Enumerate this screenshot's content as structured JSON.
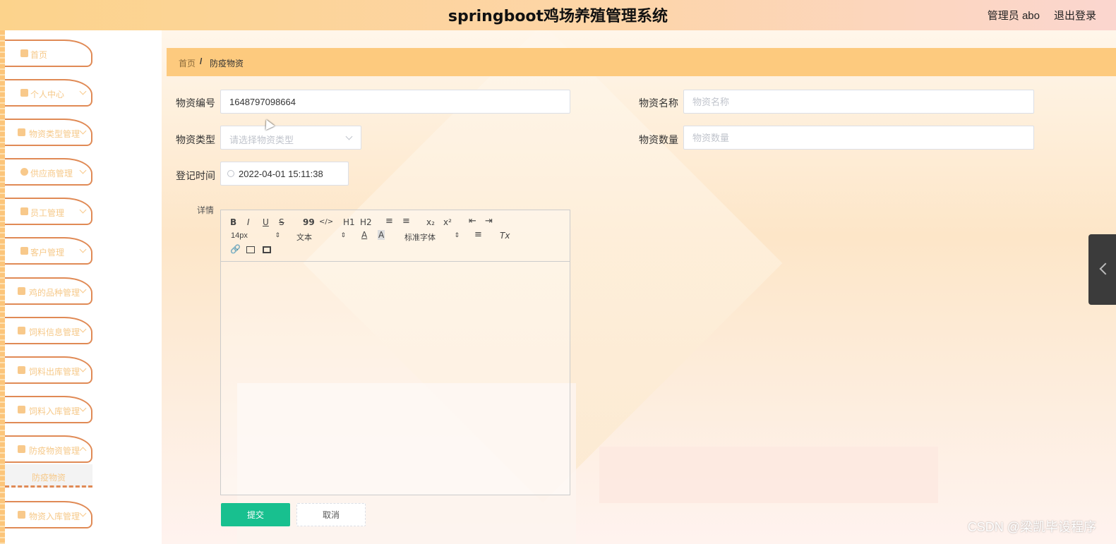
{
  "header": {
    "title": "springboot鸡场养殖管理系统",
    "user_label": "管理员 abo",
    "logout_label": "退出登录"
  },
  "sidebar": {
    "items": [
      {
        "label": "首页",
        "icon": "home-icon"
      },
      {
        "label": "个人中心",
        "icon": "user-icon"
      },
      {
        "label": "物资类型管理",
        "icon": "thumb-icon"
      },
      {
        "label": "供应商管理",
        "icon": "pin-icon"
      },
      {
        "label": "员工管理",
        "icon": "grid-icon"
      },
      {
        "label": "客户管理",
        "icon": "briefcase-icon"
      },
      {
        "label": "鸡的品种管理",
        "icon": "grid-icon"
      },
      {
        "label": "饲料信息管理",
        "icon": "grid-icon"
      },
      {
        "label": "饲料出库管理",
        "icon": "sliders-icon"
      },
      {
        "label": "饲料入库管理",
        "icon": "grid-icon"
      },
      {
        "label": "防疫物资管理",
        "icon": "doc-icon"
      },
      {
        "label": "物资入库管理",
        "icon": "grid-icon"
      }
    ],
    "active_subitem": "防疫物资"
  },
  "breadcrumb": {
    "home": "首页",
    "separator": "/",
    "current": "防疫物资"
  },
  "form": {
    "code_label": "物资编号",
    "code_value": "1648797098664",
    "name_label": "物资名称",
    "name_placeholder": "物资名称",
    "type_label": "物资类型",
    "type_placeholder": "请选择物资类型",
    "quantity_label": "物资数量",
    "quantity_placeholder": "物资数量",
    "time_label": "登记时间",
    "time_value": "2022-04-01 15:11:38",
    "detail_label": "详情"
  },
  "editor": {
    "font_size": "14px",
    "header_picker": "文本",
    "font_family": "标准字体",
    "buttons": {
      "bold": "B",
      "italic": "I",
      "underline": "U",
      "strike": "S",
      "quote": "99",
      "code": "</>",
      "h1": "H1",
      "h2": "H2",
      "subscript": "x₂",
      "superscript": "x²",
      "clean": "Tx"
    }
  },
  "actions": {
    "submit": "提交",
    "cancel": "取消"
  },
  "watermark": "CSDN @梁凯毕设程序"
}
